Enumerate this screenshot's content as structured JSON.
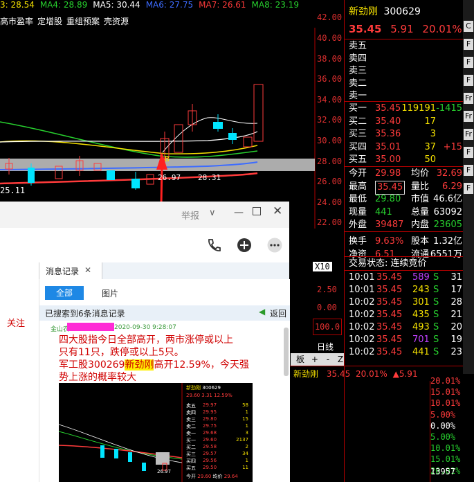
{
  "ma_bar": [
    {
      "label": "3: 28.54",
      "color": "#f5e100"
    },
    {
      "label": "MA4: 28.89",
      "color": "#27d02e"
    },
    {
      "label": "MA5: 30.44",
      "color": "#ffffff"
    },
    {
      "label": "MA6: 27.75",
      "color": "#3d6cff"
    },
    {
      "label": "MA7: 26.61",
      "color": "#ff3b3b"
    },
    {
      "label": "MA8: 23.19",
      "color": "#27d02e"
    }
  ],
  "indicators": [
    "高市盈率",
    "定增股",
    "重组预案",
    "壳资源"
  ],
  "y_ticks": [
    "42.00",
    "40.00",
    "38.00",
    "36.00",
    "34.00",
    "32.00",
    "30.00",
    "28.00",
    "26.00",
    "24.00",
    "22.00"
  ],
  "chart_labels": {
    "low_price": "25.11",
    "point_b": "B",
    "ma_readout_a": "26.97",
    "ma_readout_b": "28.31",
    "x10": "X10",
    "vol_ticks": [
      "2.50",
      "0.00"
    ],
    "tick_1000": "100.0"
  },
  "stock": {
    "name": "新劲刚",
    "code": "300629",
    "price": "35.45",
    "change": "5.91",
    "pct": "20.01%"
  },
  "asks": [
    "卖五",
    "卖四",
    "卖三",
    "卖二",
    "卖一"
  ],
  "bids": [
    {
      "label": "买一",
      "price": "35.45",
      "vol": "119191",
      "delta": "-1415"
    },
    {
      "label": "买二",
      "price": "35.40",
      "vol": "17",
      "delta": ""
    },
    {
      "label": "买三",
      "price": "35.36",
      "vol": "3",
      "delta": ""
    },
    {
      "label": "买四",
      "price": "35.01",
      "vol": "37",
      "delta": "+15"
    },
    {
      "label": "买五",
      "price": "35.00",
      "vol": "50",
      "delta": ""
    }
  ],
  "stats": [
    {
      "l1": "今开",
      "v1": "29.98",
      "l2": "均价",
      "v2": "32.69"
    },
    {
      "l1": "最高",
      "v1": "35.45",
      "l2": "量比",
      "v2": "6.29"
    },
    {
      "l1": "最低",
      "v1": "29.80",
      "l2": "市值",
      "v2": "46.6亿"
    },
    {
      "l1": "现量",
      "v1": "441",
      "l2": "总量",
      "v2": "63092"
    },
    {
      "l1": "外盘",
      "v1": "39487",
      "l2": "内盘",
      "v2": "23605"
    }
  ],
  "stats2": [
    {
      "l1": "换手",
      "v1": "9.63%",
      "l2": "股本",
      "v2": "1.32亿"
    },
    {
      "l1": "净资",
      "v1": "6.51",
      "l2": "流通",
      "v2": "6551万"
    }
  ],
  "trade_status": "交易状态: 连续竞价",
  "trades": [
    {
      "t": "10:01",
      "p": "35.45",
      "v": "589",
      "s": "S",
      "n": "31"
    },
    {
      "t": "10:01",
      "p": "35.45",
      "v": "243",
      "s": "S",
      "n": "17"
    },
    {
      "t": "10:02",
      "p": "35.45",
      "v": "301",
      "s": "S",
      "n": "28"
    },
    {
      "t": "10:02",
      "p": "35.45",
      "v": "435",
      "s": "S",
      "n": "21"
    },
    {
      "t": "10:02",
      "p": "35.45",
      "v": "493",
      "s": "S",
      "n": "20"
    },
    {
      "t": "10:02",
      "p": "35.45",
      "v": "701",
      "s": "S",
      "n": "19"
    },
    {
      "t": "10:02",
      "p": "35.45",
      "v": "441",
      "s": "S",
      "n": "23"
    }
  ],
  "day_line": "日线",
  "panel_label": "板",
  "panel_ctrls": [
    "+",
    "-",
    "Z"
  ],
  "bottom_ticker": {
    "name": "新劲刚",
    "price": "35.45",
    "pct": "20.01%",
    "change": "▲5.91"
  },
  "bottom_pcts": [
    {
      "v": "20.01%",
      "c": "#ff3b3b"
    },
    {
      "v": "15.01%",
      "c": "#ff3b3b"
    },
    {
      "v": "10.01%",
      "c": "#ff3b3b"
    },
    {
      "v": "5.00%",
      "c": "#ff3b3b"
    },
    {
      "v": "0.00%",
      "c": "#ffffff"
    },
    {
      "v": "5.00%",
      "c": "#27d02e"
    },
    {
      "v": "10.01%",
      "c": "#27d02e"
    },
    {
      "v": "15.01%",
      "c": "#27d02e"
    },
    {
      "v": "20.01%",
      "c": "#27d02e"
    }
  ],
  "bottom_vol": "13957",
  "strip_labels": [
    "C",
    "F",
    "F",
    "F",
    "Fr",
    "Fr",
    "Fr",
    "F",
    "F",
    "F"
  ],
  "chat": {
    "report": "举报",
    "tab": "消息记录",
    "filter_all": "全部",
    "filter_images": "图片",
    "result": "已搜索到6条消息记录",
    "back": "返回",
    "side_label": "关注",
    "sender": "金山农",
    "time": "2020-09-30 9:28:07",
    "msg_line1": "四大股指今日全部高开，两市涨停或以上",
    "msg_line2": "只有11只，跌停或以上5只。",
    "msg_line3a": "军工股300269",
    "msg_highlight": "新劲刚",
    "msg_line3b": "高开12.59%，今天强",
    "msg_line4": "势上涨的概率较大",
    "thumb": {
      "name": "新劲刚",
      "code": "300629",
      "price": "29.60",
      "change": "3.31",
      "pct": "12.59%",
      "asks": [
        {
          "l": "卖五",
          "p": "29.97",
          "v": "58"
        },
        {
          "l": "卖四",
          "p": "29.95",
          "v": "1"
        },
        {
          "l": "卖三",
          "p": "29.80",
          "v": "15"
        },
        {
          "l": "卖二",
          "p": "29.75",
          "v": "1"
        },
        {
          "l": "卖一",
          "p": "29.68",
          "v": "3"
        }
      ],
      "bids": [
        {
          "l": "买一",
          "p": "29.60",
          "v": "2137"
        },
        {
          "l": "买二",
          "p": "29.58",
          "v": "2"
        },
        {
          "l": "买三",
          "p": "29.57",
          "v": "34"
        },
        {
          "l": "买四",
          "p": "29.56",
          "v": "1"
        },
        {
          "l": "买五",
          "p": "29.50",
          "v": "11"
        }
      ],
      "avg_label": "均价",
      "price_label": "今开",
      "avg": "29.64",
      "open": "29.60",
      "low": "26.97"
    }
  }
}
